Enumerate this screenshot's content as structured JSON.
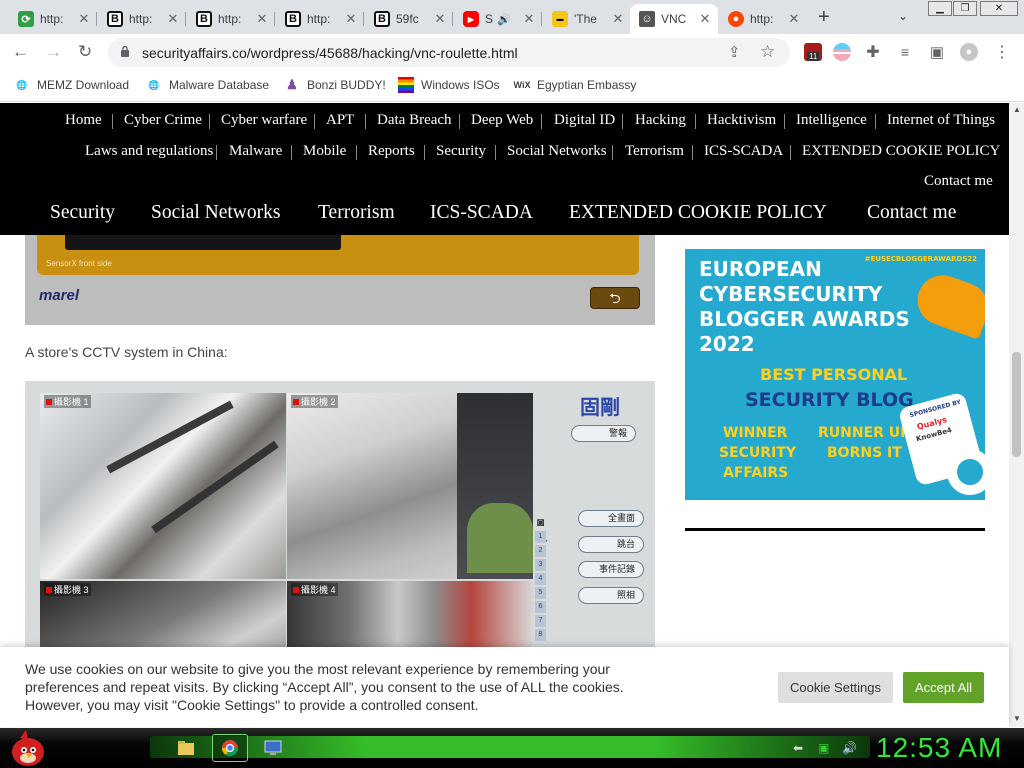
{
  "tabs": [
    {
      "title": "http:",
      "favicon": "link-icon"
    },
    {
      "title": "http:",
      "favicon": "b-icon"
    },
    {
      "title": "http:",
      "favicon": "b-icon"
    },
    {
      "title": "http:",
      "favicon": "b-icon"
    },
    {
      "title": "59fc",
      "favicon": "b-icon"
    },
    {
      "title": "S",
      "favicon": "youtube-icon"
    },
    {
      "title": "'The",
      "favicon": "imdb-icon"
    },
    {
      "title": "VNC",
      "favicon": "person-icon"
    },
    {
      "title": "http:",
      "favicon": "reddit-icon"
    }
  ],
  "toolbar": {
    "url": "securityaffairs.co/wordpress/45688/hacking/vnc-roulette.html",
    "ext_badge": "11"
  },
  "bookmarks": [
    {
      "label": "MEMZ Download",
      "icon": "globe-icon"
    },
    {
      "label": "Malware Database",
      "icon": "globe-icon"
    },
    {
      "label": "Bonzi BUDDY!",
      "icon": "bonzi-icon"
    },
    {
      "label": "Windows ISOs",
      "icon": "windows-icon"
    },
    {
      "label": "Egyptian Embassy",
      "icon": "wix-icon",
      "icon_text": "WiX"
    }
  ],
  "site_nav": {
    "row1": [
      "Home",
      "Cyber Crime",
      "Cyber warfare",
      "APT",
      "Data Breach",
      "Deep Web",
      "Digital ID",
      "Hacking",
      "Hacktivism",
      "Intelligence",
      "Internet of Things"
    ],
    "row2": [
      "Laws and regulations",
      "Malware",
      "Mobile",
      "Reports",
      "Security",
      "Social Networks",
      "Terrorism",
      "ICS-SCADA",
      "EXTENDED COOKIE POLICY"
    ],
    "row3": [
      "Contact me"
    ],
    "row_big": [
      "Security",
      "Social Networks",
      "Terrorism",
      "ICS-SCADA",
      "EXTENDED COOKIE POLICY",
      "Contact me"
    ]
  },
  "article": {
    "sensor_label": "SensorX front side",
    "brand": "marel",
    "back_symbol": "⮌",
    "caption": "A store's CCTV system in China:",
    "cctv": {
      "logo": "固剛",
      "cam_labels": [
        "攝影機 1",
        "攝影機 2",
        "攝影機 3",
        "攝影機 4"
      ],
      "buttons": [
        "警報",
        "全畫面",
        "跳台",
        "事件記錄",
        "照相"
      ],
      "numbers": [
        "1",
        "2",
        "3",
        "4",
        "5",
        "6",
        "7",
        "8"
      ]
    }
  },
  "ad": {
    "hashtag": "#EUSECBLOGGERAWARDS22",
    "title_lines": [
      "EUROPEAN",
      "CYBERSECURITY",
      "BLOGGER AWARDS",
      "2022"
    ],
    "category_lines": [
      "BEST PERSONAL",
      "SECURITY BLOG"
    ],
    "winner_lines": [
      "WINNER",
      "SECURITY",
      "AFFAIRS"
    ],
    "runner_lines": [
      "RUNNER UP",
      "BORNS IT"
    ],
    "sponsored": "SPONSORED BY",
    "sponsor1": "Qualys",
    "sponsor2": "KnowBe4"
  },
  "cookie": {
    "text": "We use cookies on our website to give you the most relevant experience by remembering your preferences and repeat visits. By clicking “Accept All”, you consent to the use of ALL the cookies. However, you may visit \"Cookie Settings\" to provide a controlled consent.",
    "settings_label": "Cookie Settings",
    "accept_label": "Accept All"
  },
  "taskbar": {
    "clock": "12:53 AM"
  },
  "colors": {
    "nav_bg": "#000000",
    "accept": "#61a229",
    "ad_bg": "#26a9cf",
    "ad_yellow": "#ffd11a",
    "clock": "#33e63a"
  }
}
